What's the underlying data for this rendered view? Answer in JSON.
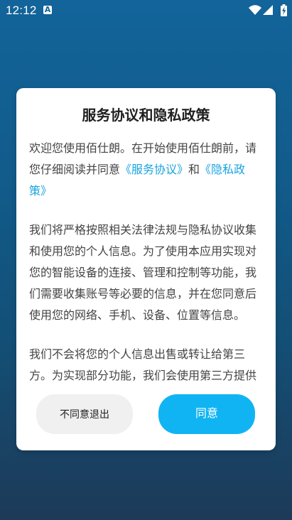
{
  "status_bar": {
    "time": "12:12",
    "notification_icon": "a-icon",
    "wifi_icon": "wifi-icon",
    "signal_icon": "signal-icon",
    "battery_icon": "battery-icon"
  },
  "dialog": {
    "title": "服务协议和隐私政策",
    "paragraph_1": {
      "before_links": "欢迎您使用佰仕朗。在开始使用佰仕朗前，请您仔细阅读并同意",
      "service_link": "《服务协议》",
      "and_text": "和",
      "privacy_link": "《隐私政策》"
    },
    "paragraph_2": "我们将严格按照相关法律法规与隐私协议收集和使用您的个人信息。为了使用本应用实现对您的智能设备的连接、管理和控制等功能，我们需要收集账号等必要的信息，并在您同意后使用您的网络、手机、设备、位置等信息。",
    "paragraph_3": "我们不会将您的个人信息出售或转让给第三方。为实现部分功能，我们会使用第三方提供",
    "buttons": {
      "decline_label": "不同意退出",
      "agree_label": "同意"
    }
  },
  "colors": {
    "background_top": "#12649A",
    "background_bottom": "#1D3A58",
    "link": "#18A4DF",
    "agree_button": "#11B4F3",
    "decline_button": "#F0F0F0"
  }
}
